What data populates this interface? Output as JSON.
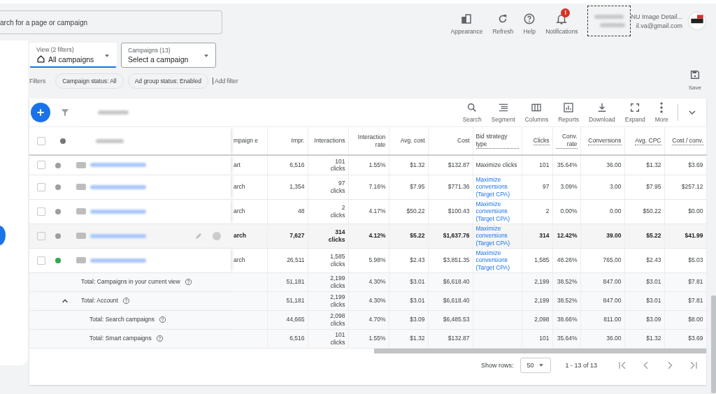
{
  "search": {
    "placeholder": "arch for a page or campaign"
  },
  "top_actions": [
    {
      "kind": "appearance",
      "label": "Appearance"
    },
    {
      "kind": "refresh",
      "label": "Refresh"
    },
    {
      "kind": "help",
      "label": "Help"
    },
    {
      "kind": "notifications",
      "label": "Notifications",
      "badge": "!"
    }
  ],
  "account": {
    "name": "NU Image Detail...",
    "email": "il.va@gmail.com"
  },
  "view": {
    "label": "View (2 filters)",
    "value": "All campaigns"
  },
  "campaign_picker": {
    "label": "Campaigns (13)",
    "value": "Select a campaign"
  },
  "filters": {
    "label": "Filters",
    "chips": [
      "Campaign status: All",
      "Ad group status: Enabled"
    ],
    "add": "Add filter"
  },
  "save": {
    "label": "Save"
  },
  "toolbar": [
    {
      "kind": "search",
      "label": "Search"
    },
    {
      "kind": "segment",
      "label": "Segment"
    },
    {
      "kind": "columns",
      "label": "Columns"
    },
    {
      "kind": "reports",
      "label": "Reports"
    },
    {
      "kind": "download",
      "label": "Download"
    },
    {
      "kind": "expand",
      "label": "Expand"
    },
    {
      "kind": "more",
      "label": "More"
    }
  ],
  "select_all": {
    "checked": false
  },
  "columns": [
    {
      "label": "mpaign e",
      "dotted": false
    },
    {
      "label": "Impr.",
      "dotted": false
    },
    {
      "label": "Interactions",
      "dotted": false
    },
    {
      "label": "Interaction rate",
      "dotted": false
    },
    {
      "label": "Avg. cost",
      "dotted": false
    },
    {
      "label": "Cost",
      "dotted": false
    },
    {
      "label": "Bid strategy type",
      "dotted": true
    },
    {
      "label": "Clicks",
      "dotted": true
    },
    {
      "label": "Conv. rate",
      "dotted": true
    },
    {
      "label": "Conversions",
      "dotted": true
    },
    {
      "label": "Avg. CPC",
      "dotted": true
    },
    {
      "label": "Cost / conv.",
      "dotted": true
    }
  ],
  "rows": [
    {
      "checked": false,
      "color": "#9e9e9e",
      "highlighted": false,
      "bid_link": false,
      "cells": [
        "art",
        "6,516",
        "101 clicks",
        "1.55%",
        "$1.32",
        "$132.87",
        "Maximize clicks",
        "101",
        "35.64%",
        "36.00",
        "$1.32",
        "$3.69"
      ]
    },
    {
      "checked": false,
      "color": "#9e9e9e",
      "highlighted": false,
      "bid_link": true,
      "cells": [
        "arch",
        "1,354",
        "97 clicks",
        "7.16%",
        "$7.95",
        "$771.36",
        "Maximize conversions (Target CPA)",
        "97",
        "3.09%",
        "3.00",
        "$7.95",
        "$257.12"
      ]
    },
    {
      "checked": false,
      "color": "#9e9e9e",
      "highlighted": false,
      "bid_link": true,
      "cells": [
        "arch",
        "48",
        "2 clicks",
        "4.17%",
        "$50.22",
        "$100.43",
        "Maximize conversions (Target CPA)",
        "2",
        "0.00%",
        "0.00",
        "$50.22",
        "$0.00"
      ]
    },
    {
      "checked": false,
      "color": "#9e9e9e",
      "highlighted": true,
      "bid_link": true,
      "cells": [
        "arch",
        "7,627",
        "314 clicks",
        "4.12%",
        "$5.22",
        "$1,637.76",
        "Maximize conversions (Target CPA)",
        "314",
        "12.42%",
        "39.00",
        "$5.22",
        "$41.99"
      ]
    },
    {
      "checked": false,
      "color": "#34a853",
      "highlighted": false,
      "bid_link": true,
      "cells": [
        "arch",
        "26,511",
        "1,585 clicks",
        "5.98%",
        "$2.43",
        "$3,851.35",
        "Maximize conversions (Target CPA)",
        "1,585",
        "48.26%",
        "765.00",
        "$2.43",
        "$5.03"
      ]
    }
  ],
  "totals": [
    {
      "label": "Total: Campaigns in your current view",
      "cells": [
        null,
        "51,181",
        "2,199 clicks",
        "4.30%",
        "$3.01",
        "$6,618.40",
        null,
        "2,199",
        "38.52%",
        "847.00",
        "$3.01",
        "$7.81"
      ]
    },
    {
      "label": "Total: Account",
      "expanded": true,
      "cells": [
        null,
        "51,181",
        "2,199 clicks",
        "4.30%",
        "$3.01",
        "$6,618.40",
        null,
        "2,199",
        "38.52%",
        "847.00",
        "$3.01",
        "$7.81"
      ],
      "children": [
        {
          "label": "Total: Search campaigns",
          "cells": [
            null,
            "44,665",
            "2,098 clicks",
            "4.70%",
            "$3.09",
            "$6,485.53",
            null,
            "2,098",
            "38.66%",
            "811.00",
            "$3.09",
            "$8.00"
          ]
        },
        {
          "label": "Total: Smart campaigns",
          "cells": [
            null,
            "6,516",
            "101 clicks",
            "1.55%",
            "$1.32",
            "$132.87",
            null,
            "101",
            "35.64%",
            "36.00",
            "$1.32",
            "$3.69"
          ]
        }
      ]
    }
  ],
  "pagination": {
    "label": "Show rows:",
    "rows": "50",
    "range": "1 - 13 of 13"
  }
}
